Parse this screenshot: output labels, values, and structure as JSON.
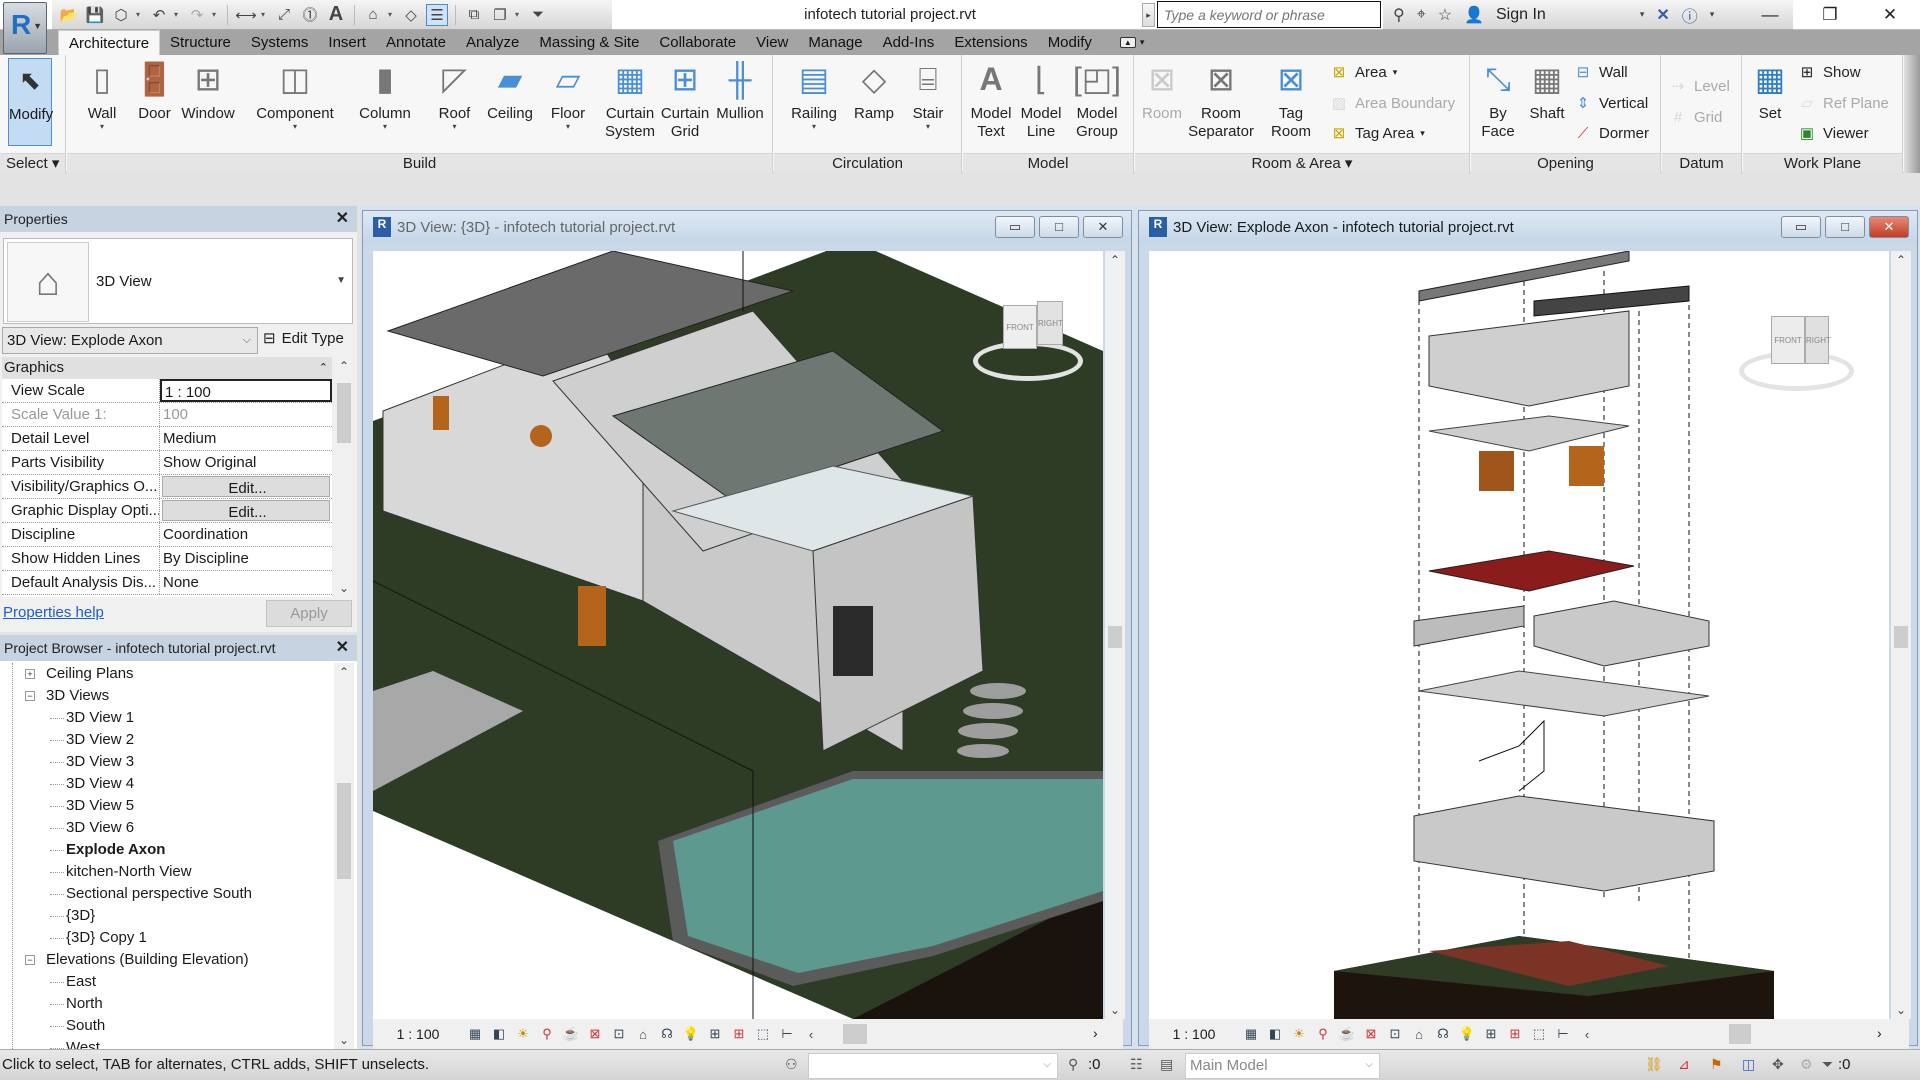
{
  "app": {
    "title": "infotech tutorial project.rvt",
    "logo_letter": "R",
    "search_placeholder": "Type a keyword or phrase",
    "sign_in": "Sign In"
  },
  "quick_access": [
    "open-icon",
    "save-icon",
    "sync-icon",
    "undo-icon",
    "redo-icon",
    "measure-icon",
    "dimension-icon",
    "tag-icon",
    "text-icon",
    "3d-view-icon",
    "section-icon",
    "thin-lines-icon",
    "close-hidden-icon",
    "switch-windows-icon",
    "customize-icon"
  ],
  "tabs": [
    {
      "label": "Architecture",
      "active": true
    },
    {
      "label": "Structure"
    },
    {
      "label": "Systems"
    },
    {
      "label": "Insert"
    },
    {
      "label": "Annotate"
    },
    {
      "label": "Analyze"
    },
    {
      "label": "Massing & Site"
    },
    {
      "label": "Collaborate"
    },
    {
      "label": "View"
    },
    {
      "label": "Manage"
    },
    {
      "label": "Add-Ins"
    },
    {
      "label": "Extensions"
    },
    {
      "label": "Modify"
    }
  ],
  "ribbon": {
    "select": {
      "title": "Select ▾",
      "modify": "Modify"
    },
    "build": {
      "title": "Build",
      "buttons": [
        {
          "label": "Wall",
          "dd": true
        },
        {
          "label": "Door"
        },
        {
          "label": "Window"
        },
        {
          "label": "Component",
          "dd": true
        },
        {
          "label": "Column",
          "dd": true
        },
        {
          "label": "Roof",
          "dd": true
        },
        {
          "label": "Ceiling"
        },
        {
          "label": "Floor",
          "dd": true
        },
        {
          "label": "Curtain\nSystem"
        },
        {
          "label": "Curtain\nGrid"
        },
        {
          "label": "Mullion"
        }
      ]
    },
    "circulation": {
      "title": "Circulation",
      "buttons": [
        {
          "label": "Railing",
          "dd": true
        },
        {
          "label": "Ramp"
        },
        {
          "label": "Stair",
          "dd": true
        }
      ]
    },
    "model": {
      "title": "Model",
      "buttons": [
        {
          "label": "Model\nText"
        },
        {
          "label": "Model\nLine"
        },
        {
          "label": "Model\nGroup"
        }
      ]
    },
    "room_area": {
      "title": "Room & Area ▾",
      "room": "Room",
      "room_separator": "Room\nSeparator",
      "tag_room": "Tag\nRoom",
      "area": "Area",
      "area_boundary": "Area  Boundary",
      "tag_area": "Tag  Area"
    },
    "opening": {
      "title": "Opening",
      "by_face": "By\nFace",
      "shaft": "Shaft",
      "wall": "Wall",
      "vertical": "Vertical",
      "dormer": "Dormer"
    },
    "datum": {
      "title": "Datum",
      "level": "Level",
      "grid": "Grid"
    },
    "work_plane": {
      "title": "Work Plane",
      "set": "Set",
      "show": "Show",
      "ref_plane": "Ref  Plane",
      "viewer": "Viewer"
    }
  },
  "properties": {
    "title": "Properties",
    "type_name": "3D View",
    "instance": "3D View: Explode Axon",
    "edit_type": "Edit Type",
    "group": "Graphics",
    "rows": [
      {
        "name": "View Scale",
        "value": "1 : 100",
        "style": "boxed"
      },
      {
        "name": "Scale Value    1:",
        "value": "100",
        "style": "gray"
      },
      {
        "name": "Detail Level",
        "value": "Medium"
      },
      {
        "name": "Parts Visibility",
        "value": "Show Original"
      },
      {
        "name": "Visibility/Graphics O...",
        "value": "Edit...",
        "style": "btn"
      },
      {
        "name": "Graphic Display Opti...",
        "value": "Edit...",
        "style": "btn"
      },
      {
        "name": "Discipline",
        "value": "Coordination"
      },
      {
        "name": "Show Hidden Lines",
        "value": "By Discipline"
      },
      {
        "name": "Default Analysis Dis...",
        "value": "None"
      }
    ],
    "help": "Properties help",
    "apply": "Apply"
  },
  "browser": {
    "title": "Project Browser - infotech tutorial project.rvt",
    "nodes": [
      {
        "label": "Ceiling Plans",
        "level": 1,
        "toggle": "+"
      },
      {
        "label": "3D Views",
        "level": 1,
        "toggle": "-"
      },
      {
        "label": "3D View 1",
        "level": 2
      },
      {
        "label": "3D View 2",
        "level": 2
      },
      {
        "label": "3D View 3",
        "level": 2
      },
      {
        "label": "3D View 4",
        "level": 2
      },
      {
        "label": "3D View 5",
        "level": 2
      },
      {
        "label": "3D View 6",
        "level": 2
      },
      {
        "label": "Explode Axon",
        "level": 2,
        "bold": true
      },
      {
        "label": "kitchen-North View",
        "level": 2
      },
      {
        "label": "Sectional perspective South",
        "level": 2
      },
      {
        "label": "{3D}",
        "level": 2
      },
      {
        "label": "{3D} Copy 1",
        "level": 2
      },
      {
        "label": "Elevations (Building Elevation)",
        "level": 1,
        "toggle": "-"
      },
      {
        "label": "East",
        "level": 2
      },
      {
        "label": "North",
        "level": 2
      },
      {
        "label": "South",
        "level": 2
      },
      {
        "label": "West",
        "level": 2
      }
    ]
  },
  "views": [
    {
      "title": "3D View: {3D} - infotech tutorial project.rvt",
      "scale": "1 : 100",
      "active": false,
      "viewcube": [
        "FRONT",
        "RIGHT"
      ]
    },
    {
      "title": "3D View: Explode Axon - infotech tutorial project.rvt",
      "scale": "1 : 100",
      "active": true,
      "viewcube": [
        "FRONT",
        "RIGHT"
      ]
    }
  ],
  "status": {
    "message": "Click to select, TAB for alternates, CTRL adds, SHIFT unselects.",
    "worksets_count": ":0",
    "design_option": "Main Model",
    "filter_count": ":0"
  },
  "colors": {
    "ribbon_tabs_bg": "#a4a4a4",
    "pane_header": "#c6d4e2",
    "grass": "#2d3a24",
    "pool": "#5f9a91",
    "accent_blue": "#4f8fd2",
    "close_red": "#c23c22"
  }
}
